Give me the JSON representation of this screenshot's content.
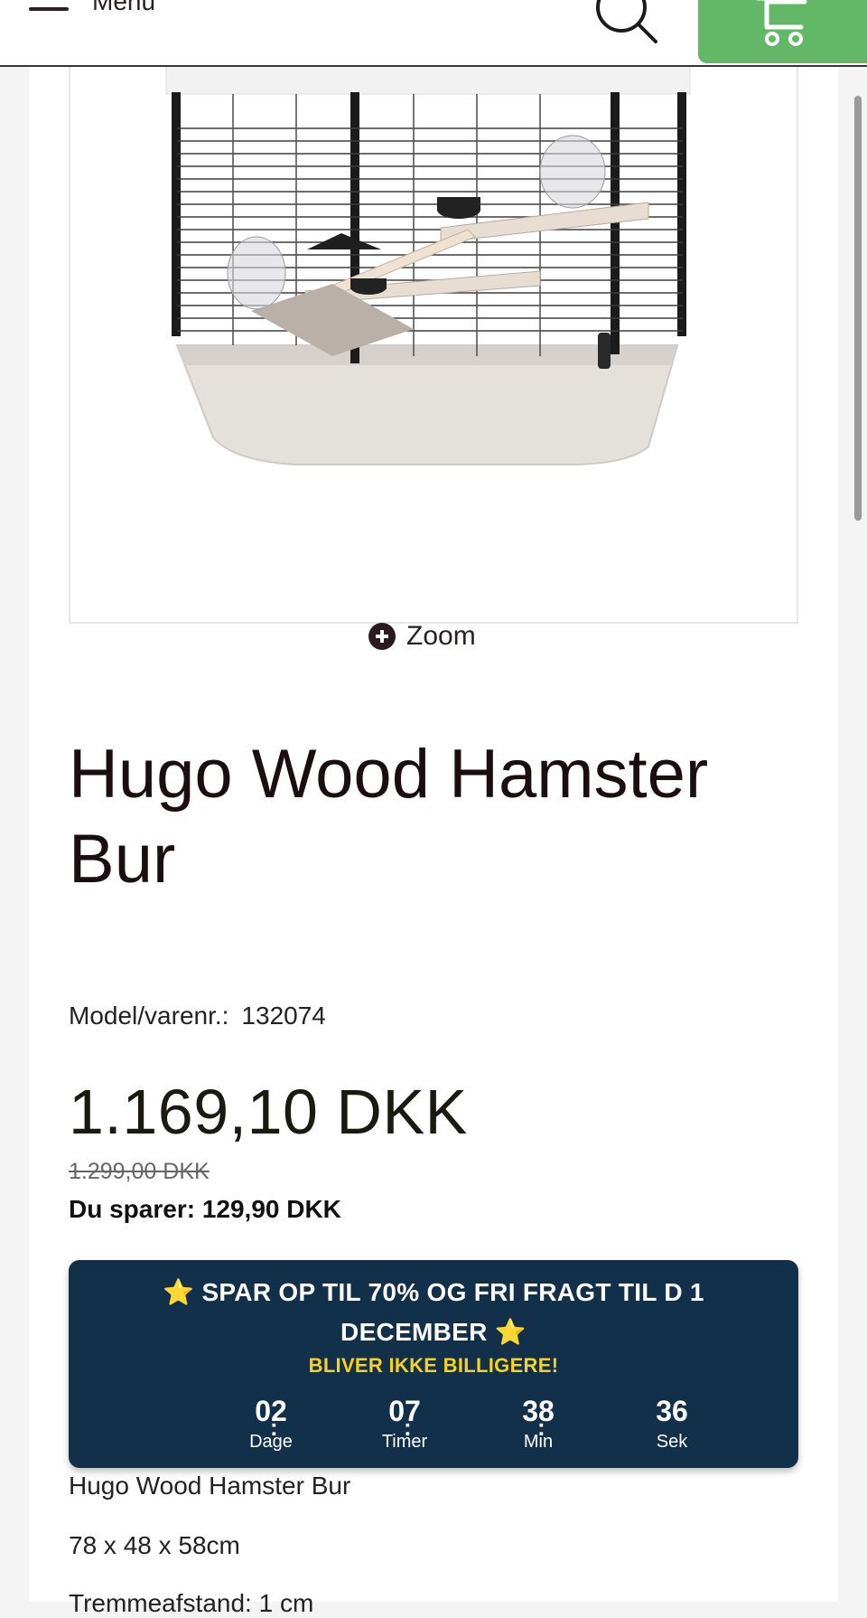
{
  "header": {
    "menu_label": "Menu",
    "menu_icon": "hamburger-icon",
    "search_icon": "search-icon",
    "cart_icon": "cart-icon",
    "cart_color": "#62b866"
  },
  "product": {
    "image_alt": "hamster-cage-photo",
    "zoom_label": "Zoom",
    "title": "Hugo Wood Hamster Bur",
    "model_label": "Model/varenr.:",
    "model_value": "132074",
    "price": "1.169,10 DKK",
    "old_price": "1.299,00 DKK",
    "savings": "Du sparer: 129,90 DKK"
  },
  "promo": {
    "headline_star": "⭐",
    "headline": "SPAR OP TIL 70% OG FRI FRAGT TIL D 1 DECEMBER",
    "subline": "BLIVER IKKE BILLIGERE!",
    "background": "#13304a",
    "accent": "#f7d21e",
    "countdown": [
      {
        "value": "02",
        "label": "Dage"
      },
      {
        "value": "07",
        "label": "Timer"
      },
      {
        "value": "38",
        "label": "Min"
      },
      {
        "value": "36",
        "label": "Sek"
      }
    ],
    "separator": ":"
  },
  "description": {
    "lines": [
      "Hugo Wood Hamster Bur",
      "78 x 48 x 58cm",
      "Tremmeafstand: 1 cm"
    ]
  }
}
